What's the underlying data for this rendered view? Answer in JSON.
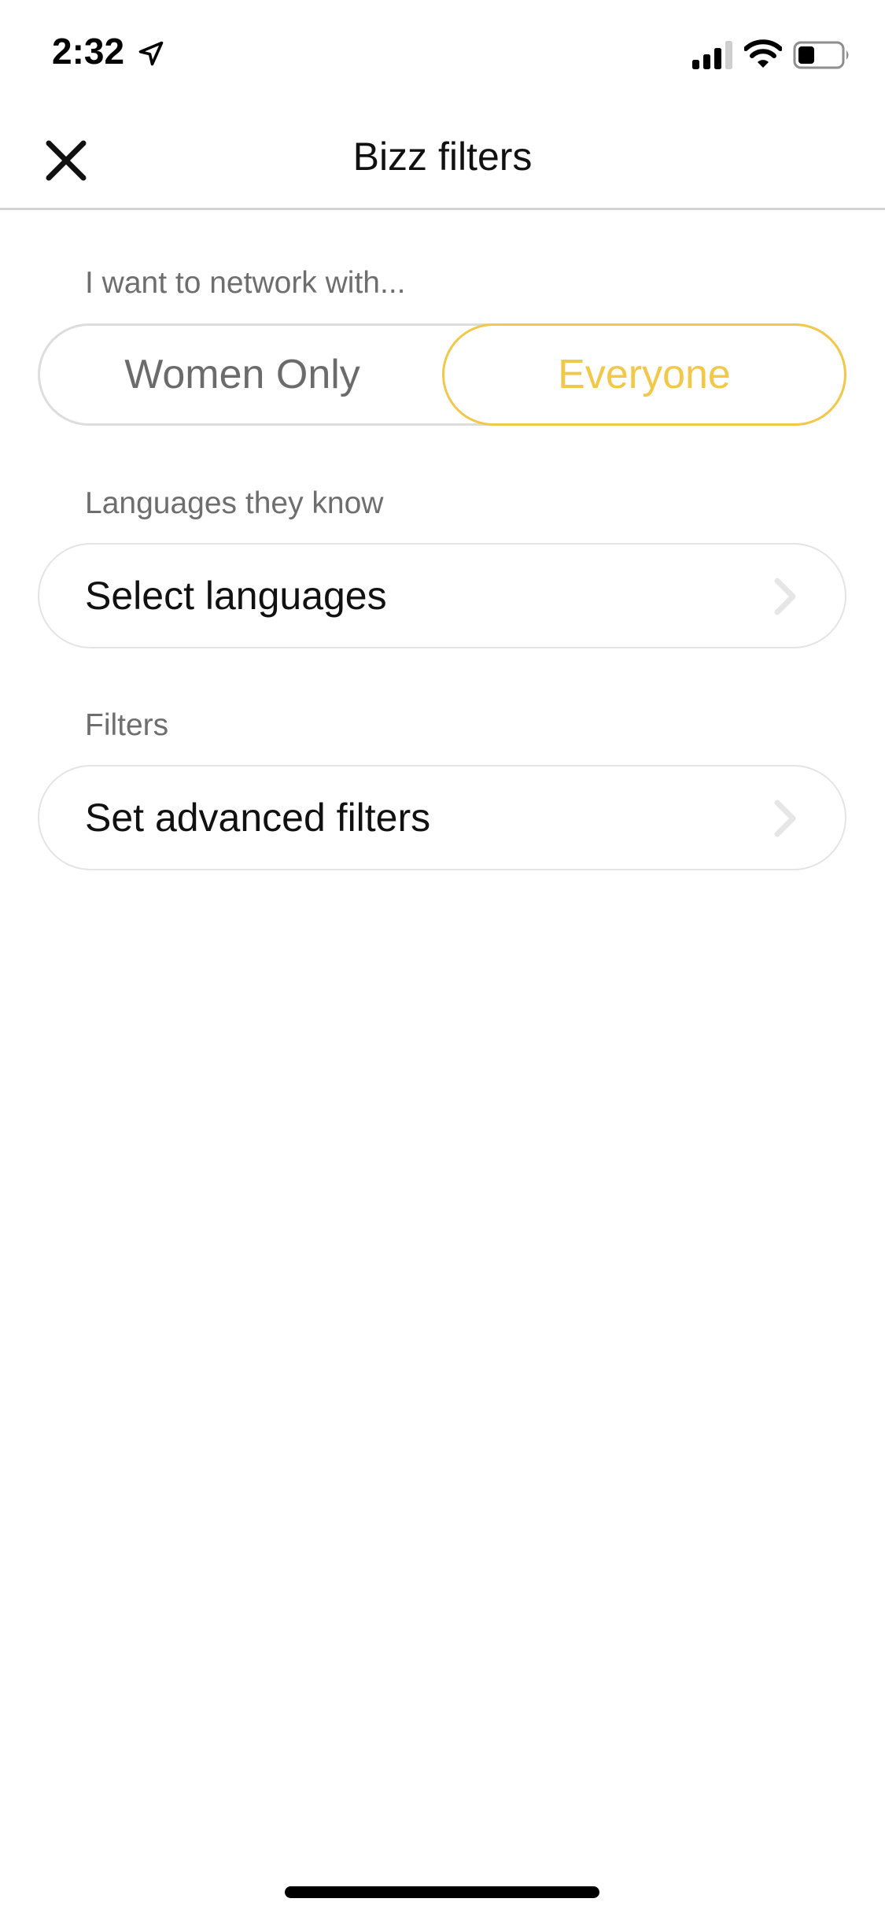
{
  "status_bar": {
    "time": "2:32",
    "icons": [
      "location-arrow-icon",
      "cellular-signal-icon",
      "wifi-icon",
      "battery-icon"
    ],
    "signal_bars_active": 3,
    "signal_bars_total": 4,
    "battery_level": 0.35
  },
  "header": {
    "title": "Bizz filters",
    "close_icon": "close-icon"
  },
  "network_section": {
    "label": "I want to network with...",
    "options": [
      {
        "label": "Women Only",
        "selected": false
      },
      {
        "label": "Everyone",
        "selected": true
      }
    ]
  },
  "languages_section": {
    "label": "Languages they know",
    "row_label": "Select languages",
    "icon": "chevron-right-icon"
  },
  "filters_section": {
    "label": "Filters",
    "row_label": "Set advanced filters",
    "icon": "chevron-right-icon"
  },
  "colors": {
    "accent": "#f2c84b",
    "secondary_text": "#6e6e6e",
    "border": "#dddddd"
  }
}
